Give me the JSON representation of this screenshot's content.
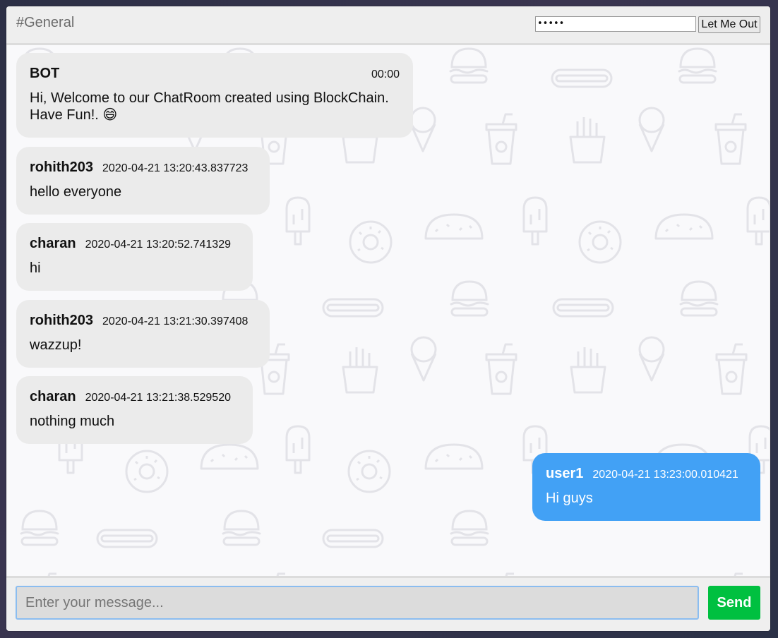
{
  "header": {
    "channel_title": "#General",
    "password_value": "•••••",
    "logout_label": "Let Me Out"
  },
  "messages": [
    {
      "sender": "BOT",
      "time": "00:00",
      "text": "Hi, Welcome to our ChatRoom created using BlockChain. Have Fun!. 😄",
      "own": false
    },
    {
      "sender": "rohith203",
      "time": "2020-04-21 13:20:43.837723",
      "text": "hello everyone",
      "own": false
    },
    {
      "sender": "charan",
      "time": "2020-04-21 13:20:52.741329",
      "text": "hi",
      "own": false
    },
    {
      "sender": "rohith203",
      "time": "2020-04-21 13:21:30.397408",
      "text": "wazzup!",
      "own": false
    },
    {
      "sender": "charan",
      "time": "2020-04-21 13:21:38.529520",
      "text": "nothing much",
      "own": false
    },
    {
      "sender": "user1",
      "time": "2020-04-21 13:23:00.010421",
      "text": "Hi guys",
      "own": true
    }
  ],
  "composer": {
    "placeholder": "Enter your message...",
    "value": "",
    "send_label": "Send"
  },
  "colors": {
    "own_bubble": "#42a1f5",
    "other_bubble": "#ebebeb",
    "send_button": "#00c040"
  },
  "background_icons": [
    "burger-icon",
    "hotdog-icon",
    "ice-cream-icon",
    "soda-cup-icon",
    "fries-icon",
    "popsicle-icon",
    "donut-icon",
    "taco-icon"
  ]
}
